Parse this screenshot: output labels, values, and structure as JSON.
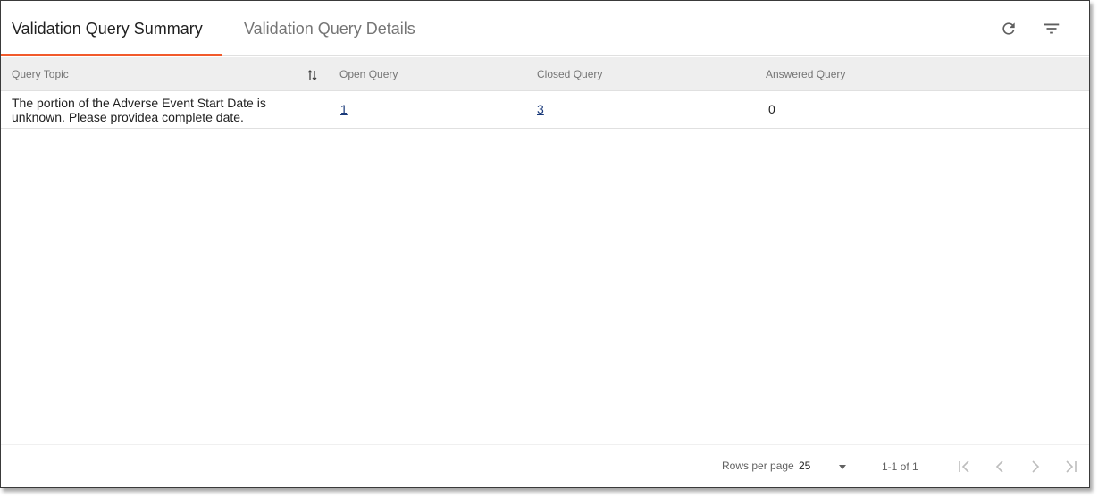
{
  "tabs": [
    {
      "label": "Validation Query Summary",
      "active": true
    },
    {
      "label": "Validation Query Details",
      "active": false
    }
  ],
  "toolbar": {
    "refresh_icon": "refresh-icon",
    "filter_icon": "filter-icon"
  },
  "table": {
    "columns": [
      "Query Topic",
      "Open Query",
      "Closed Query",
      "Answered Query"
    ],
    "rows": [
      {
        "query_topic": "The portion of the Adverse Event Start Date is unknown. Please providea complete date.",
        "open_query": "1",
        "closed_query": "3",
        "answered_query": "0"
      }
    ]
  },
  "pagination": {
    "rows_per_page_label": "Rows per page",
    "rows_per_page_value": "25",
    "range_text": "1-1 of 1"
  },
  "colors": {
    "accent": "#f15a2b",
    "header_bg": "#eeeeee",
    "link": "#1a3a7a"
  }
}
